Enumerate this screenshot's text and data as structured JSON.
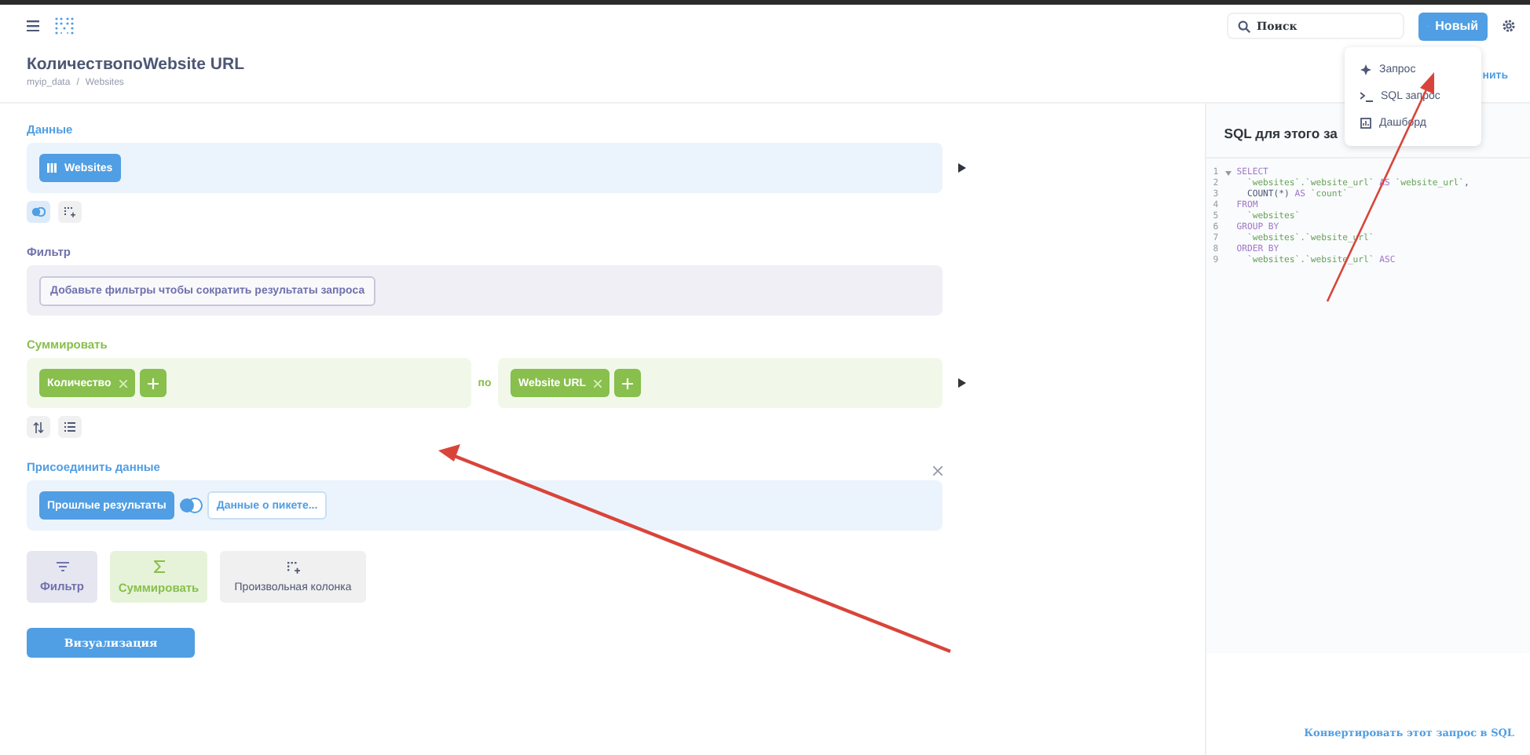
{
  "topbar": {
    "search": {
      "placeholder": "Поиск"
    },
    "new_button": "Новый"
  },
  "header": {
    "title": "КоличествопоWebsite URL",
    "breadcrumb": [
      "myip_data",
      "/",
      "Websites"
    ],
    "save_fragment": "нить"
  },
  "menu": {
    "items": [
      {
        "kind": "query",
        "label": "Запрос"
      },
      {
        "kind": "sql",
        "label": "SQL запрос"
      },
      {
        "kind": "dashboard",
        "label": "Дашборд"
      }
    ]
  },
  "data_section": {
    "label": "Данные",
    "table": "Websites"
  },
  "filter_section": {
    "label": "Фильтр",
    "hint": "Добавьте фильтры чтобы сократить результаты запроса"
  },
  "summarize_section": {
    "label": "Суммировать",
    "metrics": [
      "Количество"
    ],
    "by": "по",
    "groups": [
      "Website URL"
    ]
  },
  "join_section": {
    "label": "Присоединить данные",
    "source": "Прошлые результаты",
    "target": "Данные о пикете..."
  },
  "actions": [
    {
      "kind": "filter",
      "label": "Фильтр"
    },
    {
      "kind": "summarize",
      "label": "Суммировать"
    },
    {
      "kind": "custom",
      "label": "Произвольная колонка"
    }
  ],
  "visualize_button": "Визуализация",
  "sql_panel": {
    "title": "SQL для этого за",
    "lines": [
      {
        "n": "1",
        "fold": true,
        "tokens": [
          {
            "kind": "kw",
            "text": "SELECT"
          }
        ]
      },
      {
        "n": "2",
        "fold": false,
        "tokens": [
          {
            "kind": "str",
            "text": "  `websites`.`website_url`"
          },
          {
            "kind": "kw",
            "text": " AS "
          },
          {
            "kind": "str",
            "text": "`website_url`"
          },
          {
            "kind": "plain",
            "text": ","
          }
        ]
      },
      {
        "n": "3",
        "fold": false,
        "tokens": [
          {
            "kind": "plain",
            "text": "  COUNT(*)"
          },
          {
            "kind": "kw",
            "text": " AS "
          },
          {
            "kind": "str",
            "text": "`count`"
          }
        ]
      },
      {
        "n": "4",
        "fold": false,
        "tokens": [
          {
            "kind": "kw",
            "text": "FROM"
          }
        ]
      },
      {
        "n": "5",
        "fold": false,
        "tokens": [
          {
            "kind": "str",
            "text": "  `websites`"
          }
        ]
      },
      {
        "n": "6",
        "fold": false,
        "tokens": [
          {
            "kind": "kw",
            "text": "GROUP BY"
          }
        ]
      },
      {
        "n": "7",
        "fold": false,
        "tokens": [
          {
            "kind": "str",
            "text": "  `websites`.`website_url`"
          }
        ]
      },
      {
        "n": "8",
        "fold": false,
        "tokens": [
          {
            "kind": "kw",
            "text": "ORDER BY"
          }
        ]
      },
      {
        "n": "9",
        "fold": false,
        "tokens": [
          {
            "kind": "str",
            "text": "  `websites`.`website_url`"
          },
          {
            "kind": "kw",
            "text": " ASC"
          }
        ]
      }
    ],
    "convert_link": "Конвертировать этот запрос в SQL"
  }
}
